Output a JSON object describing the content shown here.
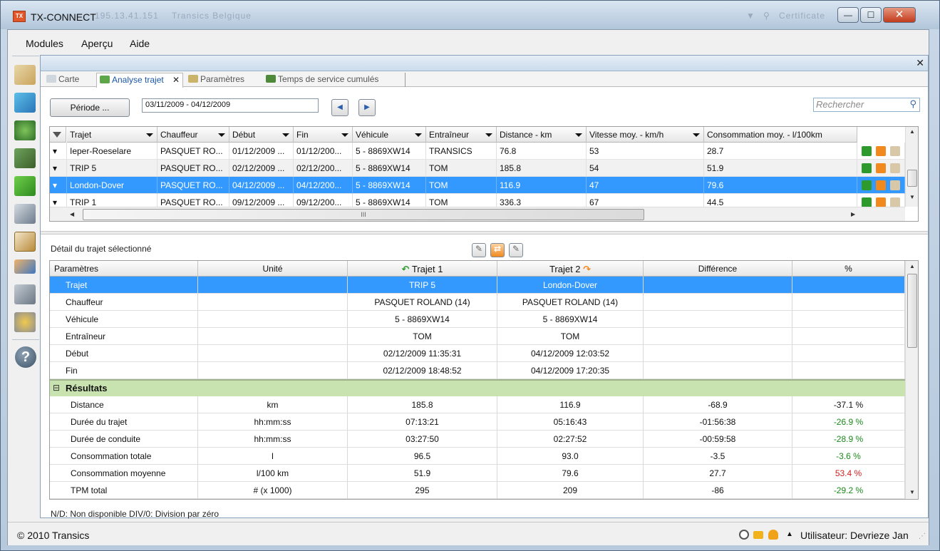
{
  "window": {
    "title": "TX-CONNECT",
    "logo_text": "TX",
    "blurred_ip": "195.13.41.151",
    "blurred_profile": "Transics Belgique",
    "minimize": "—",
    "maximize": "☐",
    "close": "✕",
    "certificate_label": "Certificate"
  },
  "menu": {
    "modules": "Modules",
    "apercu": "Aperçu",
    "aide": "Aide"
  },
  "panel": {
    "close": "✕"
  },
  "tabs": {
    "carte": "Carte",
    "analyse": "Analyse trajet",
    "analyse_close": "✕",
    "parametres": "Paramètres",
    "temps": "Temps de service cumulés"
  },
  "filters": {
    "periode_button": "Période ...",
    "period_value": "03/11/2009 - 04/12/2009",
    "prev": "◀",
    "next": "▶",
    "search_placeholder": "Rechercher"
  },
  "trips_table": {
    "columns": [
      "Trajet",
      "Chauffeur",
      "Début",
      "Fin",
      "Véhicule",
      "Entraîneur",
      "Distance - km",
      "Vitesse moy. - km/h",
      "Consommation moy. - l/100km"
    ],
    "rows": [
      [
        "Ieper-Roeselare",
        "PASQUET RO...",
        "01/12/2009 ...",
        "01/12/200...",
        "5 - 8869XW14",
        "TRANSICS",
        "76.8",
        "53",
        "28.7"
      ],
      [
        "TRIP 5",
        "PASQUET RO...",
        "02/12/2009 ...",
        "02/12/200...",
        "5 - 8869XW14",
        "TOM",
        "185.8",
        "54",
        "51.9"
      ],
      [
        "London-Dover",
        "PASQUET RO...",
        "04/12/2009 ...",
        "04/12/200...",
        "5 - 8869XW14",
        "TOM",
        "116.9",
        "47",
        "79.6"
      ],
      [
        "TRIP 1",
        "PASQUET RO...",
        "09/12/2009 ...",
        "09/12/200...",
        "5 - 8869XW14",
        "TOM",
        "336.3",
        "67",
        "44.5"
      ]
    ],
    "hscroll_grip": "III"
  },
  "detail": {
    "title": "Détail du trajet sélectionné",
    "columns": {
      "parametres": "Paramètres",
      "unite": "Unité",
      "trajet1": "Trajet 1",
      "trajet2": "Trajet 2",
      "difference": "Différence",
      "percent": "%"
    },
    "info_rows": [
      {
        "label": "Trajet",
        "unit": "",
        "t1": "TRIP 5",
        "t2": "London-Dover",
        "diff": "",
        "pct": ""
      },
      {
        "label": "Chauffeur",
        "unit": "",
        "t1": "PASQUET  ROLAND (14)",
        "t2": "PASQUET  ROLAND (14)",
        "diff": "",
        "pct": ""
      },
      {
        "label": "Véhicule",
        "unit": "",
        "t1": "5 - 8869XW14",
        "t2": "5 - 8869XW14",
        "diff": "",
        "pct": ""
      },
      {
        "label": "Entraîneur",
        "unit": "",
        "t1": "TOM",
        "t2": "TOM",
        "diff": "",
        "pct": ""
      },
      {
        "label": "Début",
        "unit": "",
        "t1": "02/12/2009 11:35:31",
        "t2": "04/12/2009 12:03:52",
        "diff": "",
        "pct": ""
      },
      {
        "label": "Fin",
        "unit": "",
        "t1": "02/12/2009 18:48:52",
        "t2": "04/12/2009 17:20:35",
        "diff": "",
        "pct": ""
      }
    ],
    "group_toggle": "⊟",
    "group_label": "Résultats",
    "result_rows": [
      {
        "label": "Distance",
        "unit": "km",
        "t1": "185.8",
        "t2": "116.9",
        "diff": "-68.9",
        "pct": "-37.1 %",
        "pct_color": "#111111"
      },
      {
        "label": "Durée du trajet",
        "unit": "hh:mm:ss",
        "t1": "07:13:21",
        "t2": "05:16:43",
        "diff": "-01:56:38",
        "pct": "-26.9 %",
        "pct_color": "#1a8a1a"
      },
      {
        "label": "Durée de conduite",
        "unit": "hh:mm:ss",
        "t1": "03:27:50",
        "t2": "02:27:52",
        "diff": "-00:59:58",
        "pct": "-28.9 %",
        "pct_color": "#1a8a1a"
      },
      {
        "label": "Consommation totale",
        "unit": "l",
        "t1": "96.5",
        "t2": "93.0",
        "diff": "-3.5",
        "pct": "-3.6 %",
        "pct_color": "#1a8a1a"
      },
      {
        "label": "Consommation moyenne",
        "unit": "l/100 km",
        "t1": "51.9",
        "t2": "79.6",
        "diff": "27.7",
        "pct": "53.4 %",
        "pct_color": "#d42020"
      },
      {
        "label": "TPM total",
        "unit": "# (x 1000)",
        "t1": "295",
        "t2": "209",
        "diff": "-86",
        "pct": "-29.2 %",
        "pct_color": "#1a8a1a"
      }
    ],
    "footnote": "N/D: Non disponible   DIV/0: Division par zéro"
  },
  "status": {
    "copyright": "© 2010 Transics",
    "user": "Utilisateur: Devrieze Jan",
    "up_arrow": "▲"
  },
  "colors": {
    "selection": "#3399ff",
    "group_bg": "#c8e2b0",
    "accent_orange": "#f08a1e",
    "accent_green": "#2e9a2e"
  }
}
